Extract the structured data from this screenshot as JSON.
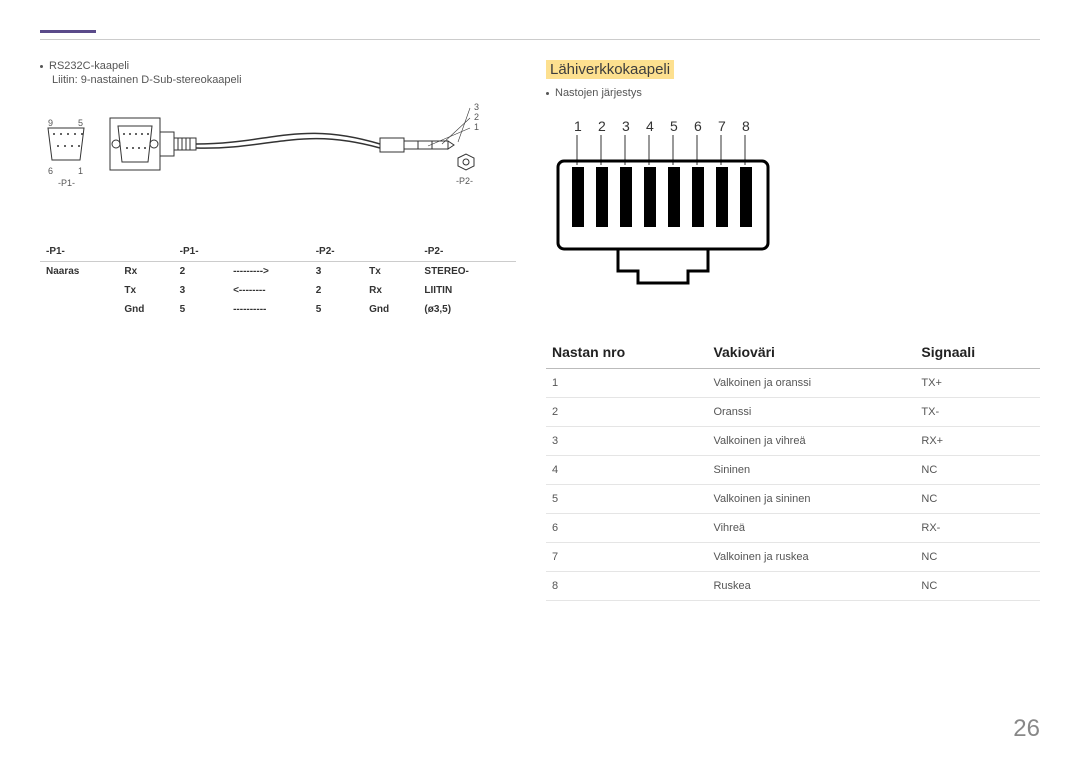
{
  "left": {
    "bullet": "RS232C-kaapeli",
    "subline": "Liitin: 9-nastainen D-Sub-stereokaapeli",
    "p1_label": "-P1-",
    "p2_label": "-P2-",
    "db9": {
      "tl": "9",
      "tr": "5",
      "bl": "6",
      "br": "1",
      "under": "-P1-"
    },
    "stereo": {
      "t": "3",
      "m": "2",
      "b": "1",
      "under": "-P2-"
    },
    "headers": [
      "-P1-",
      "-P1-",
      "",
      "-P2-",
      "-P2-",
      ""
    ],
    "rows": [
      [
        "Naaras",
        "Rx",
        "2",
        "--------->",
        "3",
        "Tx",
        "STEREO-"
      ],
      [
        "",
        "Tx",
        "3",
        "<--------",
        "2",
        "Rx",
        "LIITIN"
      ],
      [
        "",
        "Gnd",
        "5",
        "----------",
        "5",
        "Gnd",
        "(ø3,5)"
      ]
    ]
  },
  "right": {
    "heading": "Lähiverkkokaapeli",
    "bullet": "Nastojen järjestys",
    "rj45_nums": [
      "1",
      "2",
      "3",
      "4",
      "5",
      "6",
      "7",
      "8"
    ],
    "headers": [
      "Nastan nro",
      "Vakioväri",
      "Signaali"
    ],
    "rows": [
      [
        "1",
        "Valkoinen ja oranssi",
        "TX+"
      ],
      [
        "2",
        "Oranssi",
        "TX-"
      ],
      [
        "3",
        "Valkoinen ja vihreä",
        "RX+"
      ],
      [
        "4",
        "Sininen",
        "NC"
      ],
      [
        "5",
        "Valkoinen ja sininen",
        "NC"
      ],
      [
        "6",
        "Vihreä",
        "RX-"
      ],
      [
        "7",
        "Valkoinen ja ruskea",
        "NC"
      ],
      [
        "8",
        "Ruskea",
        "NC"
      ]
    ]
  },
  "page": "26"
}
